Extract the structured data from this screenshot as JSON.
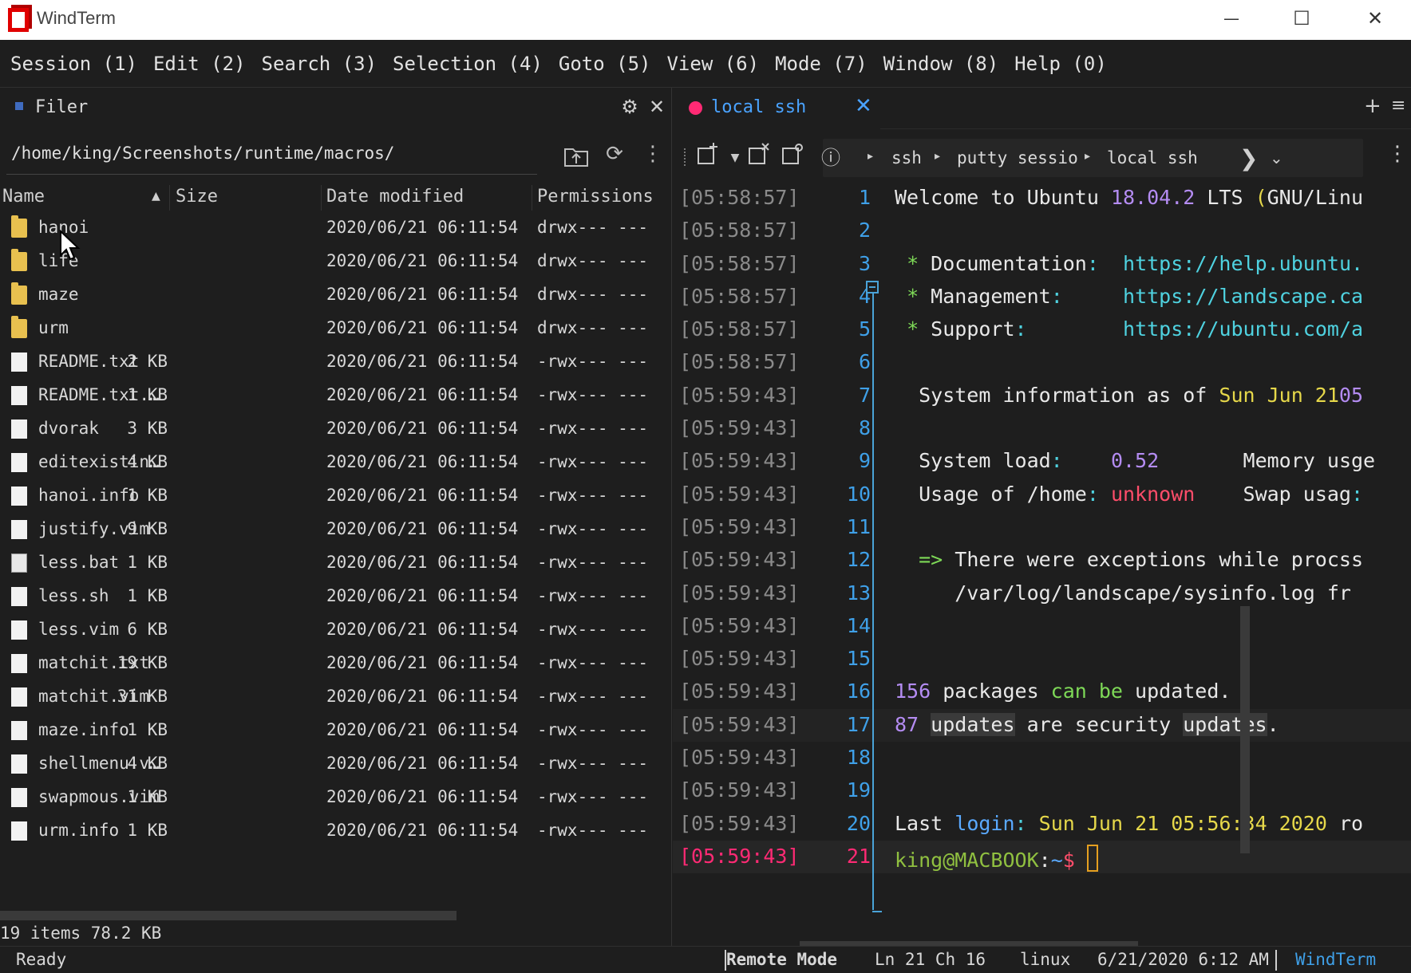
{
  "window": {
    "title": "WindTerm",
    "minimize_glyph": "—",
    "maximize_glyph": "☐",
    "close_glyph": "✕"
  },
  "menu": [
    {
      "label": "Session (1)"
    },
    {
      "label": "Edit (2)"
    },
    {
      "label": "Search (3)"
    },
    {
      "label": "Selection (4)"
    },
    {
      "label": "Goto (5)"
    },
    {
      "label": "View (6)"
    },
    {
      "label": "Mode (7)"
    },
    {
      "label": "Window (8)"
    },
    {
      "label": "Help (0)"
    }
  ],
  "filer": {
    "title": "Filer",
    "path": "/home/king/Screenshots/runtime/macros/",
    "columns": {
      "name": "Name",
      "size": "Size",
      "date": "Date modified",
      "perm": "Permissions"
    },
    "files": [
      {
        "name": "hanoi",
        "size": "",
        "date": "2020/06/21 06:11:54",
        "perm": "drwx--- ---",
        "type": "folder"
      },
      {
        "name": "life",
        "size": "",
        "date": "2020/06/21 06:11:54",
        "perm": "drwx--- ---",
        "type": "folder"
      },
      {
        "name": "maze",
        "size": "",
        "date": "2020/06/21 06:11:54",
        "perm": "drwx--- ---",
        "type": "folder"
      },
      {
        "name": "urm",
        "size": "",
        "date": "2020/06/21 06:11:54",
        "perm": "drwx--- ---",
        "type": "folder"
      },
      {
        "name": "README.txt",
        "size": "2 KB",
        "date": "2020/06/21 06:11:54",
        "perm": "-rwx--- ---",
        "type": "doc"
      },
      {
        "name": "README.txt.…",
        "size": "1 KB",
        "date": "2020/06/21 06:11:54",
        "perm": "-rwx--- ---",
        "type": "doc"
      },
      {
        "name": "dvorak",
        "size": "3 KB",
        "date": "2020/06/21 06:11:54",
        "perm": "-rwx--- ---",
        "type": "doc"
      },
      {
        "name": "editexistin…",
        "size": "4 KB",
        "date": "2020/06/21 06:11:54",
        "perm": "-rwx--- ---",
        "type": "doc"
      },
      {
        "name": "hanoi.info",
        "size": "1 KB",
        "date": "2020/06/21 06:11:54",
        "perm": "-rwx--- ---",
        "type": "doc"
      },
      {
        "name": "justify.vim",
        "size": "9 KB",
        "date": "2020/06/21 06:11:54",
        "perm": "-rwx--- ---",
        "type": "doc"
      },
      {
        "name": "less.bat",
        "size": "1 KB",
        "date": "2020/06/21 06:11:54",
        "perm": "-rwx--- ---",
        "type": "bat"
      },
      {
        "name": "less.sh",
        "size": "1 KB",
        "date": "2020/06/21 06:11:54",
        "perm": "-rwx--- ---",
        "type": "doc"
      },
      {
        "name": "less.vim",
        "size": "6 KB",
        "date": "2020/06/21 06:11:54",
        "perm": "-rwx--- ---",
        "type": "doc"
      },
      {
        "name": "matchit.txt",
        "size": "19 KB",
        "date": "2020/06/21 06:11:54",
        "perm": "-rwx--- ---",
        "type": "doc"
      },
      {
        "name": "matchit.vim",
        "size": "31 KB",
        "date": "2020/06/21 06:11:54",
        "perm": "-rwx--- ---",
        "type": "doc"
      },
      {
        "name": "maze.info",
        "size": "1 KB",
        "date": "2020/06/21 06:11:54",
        "perm": "-rwx--- ---",
        "type": "doc"
      },
      {
        "name": "shellmenu.v…",
        "size": "4 KB",
        "date": "2020/06/21 06:11:54",
        "perm": "-rwx--- ---",
        "type": "doc"
      },
      {
        "name": "swapmous.vim",
        "size": "1 KB",
        "date": "2020/06/21 06:11:54",
        "perm": "-rwx--- ---",
        "type": "doc"
      },
      {
        "name": "urm.info",
        "size": "1 KB",
        "date": "2020/06/21 06:11:54",
        "perm": "-rwx--- ---",
        "type": "doc"
      }
    ],
    "status": "19 items 78.2 KB"
  },
  "terminal": {
    "tab_label": "local ssh",
    "tab_color": "#ff2a74",
    "breadcrumbs": [
      "ssh",
      "putty sessio",
      "local ssh"
    ],
    "lines": [
      {
        "ts": "[05:58:57]",
        "ln": "1",
        "segs": [
          [
            "Welcome to Ubuntu ",
            ""
          ],
          [
            "18.04.2",
            "c-purple"
          ],
          [
            " LTS ",
            ""
          ],
          [
            "(",
            "c-yellow"
          ],
          [
            "GNU/Linu",
            ""
          ]
        ]
      },
      {
        "ts": "[05:58:57]",
        "ln": "2",
        "segs": []
      },
      {
        "ts": "[05:58:57]",
        "ln": "3",
        "segs": [
          [
            " ",
            ""
          ],
          [
            "*",
            "c-green"
          ],
          [
            " Documentation",
            ""
          ],
          [
            ":",
            "c-cyan"
          ],
          [
            "  ",
            ""
          ],
          [
            "https://help.ubuntu.",
            "c-cyan"
          ]
        ]
      },
      {
        "ts": "[05:58:57]",
        "ln": "4",
        "segs": [
          [
            " ",
            ""
          ],
          [
            "*",
            "c-green"
          ],
          [
            " Management",
            ""
          ],
          [
            ":",
            "c-cyan"
          ],
          [
            "     ",
            ""
          ],
          [
            "https://landscape.ca",
            "c-cyan"
          ]
        ]
      },
      {
        "ts": "[05:58:57]",
        "ln": "5",
        "segs": [
          [
            " ",
            ""
          ],
          [
            "*",
            "c-green"
          ],
          [
            " Support",
            ""
          ],
          [
            ":",
            "c-cyan"
          ],
          [
            "        ",
            ""
          ],
          [
            "https://ubuntu.com/a",
            "c-cyan"
          ]
        ]
      },
      {
        "ts": "[05:58:57]",
        "ln": "6",
        "segs": []
      },
      {
        "ts": "[05:59:43]",
        "ln": "7",
        "segs": [
          [
            "  System information as of ",
            ""
          ],
          [
            "Sun Jun 21",
            "c-yellow"
          ],
          [
            "05",
            "c-purple"
          ]
        ]
      },
      {
        "ts": "[05:59:43]",
        "ln": "8",
        "segs": []
      },
      {
        "ts": "[05:59:43]",
        "ln": "9",
        "segs": [
          [
            "  System load",
            ""
          ],
          [
            ":",
            "c-cyan"
          ],
          [
            "    ",
            ""
          ],
          [
            "0.52",
            "c-purple"
          ],
          [
            "       Memory usge",
            ""
          ]
        ]
      },
      {
        "ts": "[05:59:43]",
        "ln": "10",
        "segs": [
          [
            "  Usage of /home",
            ""
          ],
          [
            ":",
            "c-cyan"
          ],
          [
            " ",
            ""
          ],
          [
            "unknown",
            "c-red"
          ],
          [
            "    Swap usag",
            ""
          ],
          [
            ":",
            "c-cyan"
          ]
        ]
      },
      {
        "ts": "[05:59:43]",
        "ln": "11",
        "segs": []
      },
      {
        "ts": "[05:59:43]",
        "ln": "12",
        "segs": [
          [
            "  ",
            ""
          ],
          [
            "=>",
            "c-green"
          ],
          [
            " There were exceptions while procss",
            ""
          ]
        ]
      },
      {
        "ts": "[05:59:43]",
        "ln": "13",
        "segs": [
          [
            "     /var/log/landscape/sysinfo.log fr",
            ""
          ]
        ]
      },
      {
        "ts": "[05:59:43]",
        "ln": "14",
        "segs": []
      },
      {
        "ts": "[05:59:43]",
        "ln": "15",
        "segs": []
      },
      {
        "ts": "[05:59:43]",
        "ln": "16",
        "segs": [
          [
            "156",
            "c-purple"
          ],
          [
            " packages ",
            ""
          ],
          [
            "can be",
            "c-green"
          ],
          [
            " updated.",
            ""
          ]
        ]
      },
      {
        "ts": "[05:59:43]",
        "ln": "17",
        "segs": [
          [
            "87",
            "c-purple"
          ],
          [
            " ",
            ""
          ],
          [
            "updates",
            "hl"
          ],
          [
            " are security ",
            ""
          ],
          [
            "updates",
            "hl"
          ],
          [
            ".",
            ""
          ]
        ],
        "band": true
      },
      {
        "ts": "[05:59:43]",
        "ln": "18",
        "segs": []
      },
      {
        "ts": "[05:59:43]",
        "ln": "19",
        "segs": []
      },
      {
        "ts": "[05:59:43]",
        "ln": "20",
        "segs": [
          [
            "Last ",
            ""
          ],
          [
            "login",
            "c-blue"
          ],
          [
            ":",
            "c-cyan"
          ],
          [
            " ",
            ""
          ],
          [
            "Sun Jun 21 05:56:34 2020",
            "c-yellow"
          ],
          [
            " ro",
            ""
          ]
        ]
      },
      {
        "ts": "[05:59:43]",
        "ln": "21",
        "segs": [
          [
            "king@MACBOOK",
            "c-prompt"
          ],
          [
            ":",
            ""
          ],
          [
            "~",
            "c-blue"
          ],
          [
            "$ ",
            "c-red"
          ]
        ],
        "current": true
      }
    ]
  },
  "status": {
    "ready": "Ready",
    "mode": "Remote Mode",
    "position": "Ln 21 Ch 16",
    "os": "linux",
    "datetime": "6/21/2020 6:12 AM",
    "brand": "WindTerm"
  }
}
